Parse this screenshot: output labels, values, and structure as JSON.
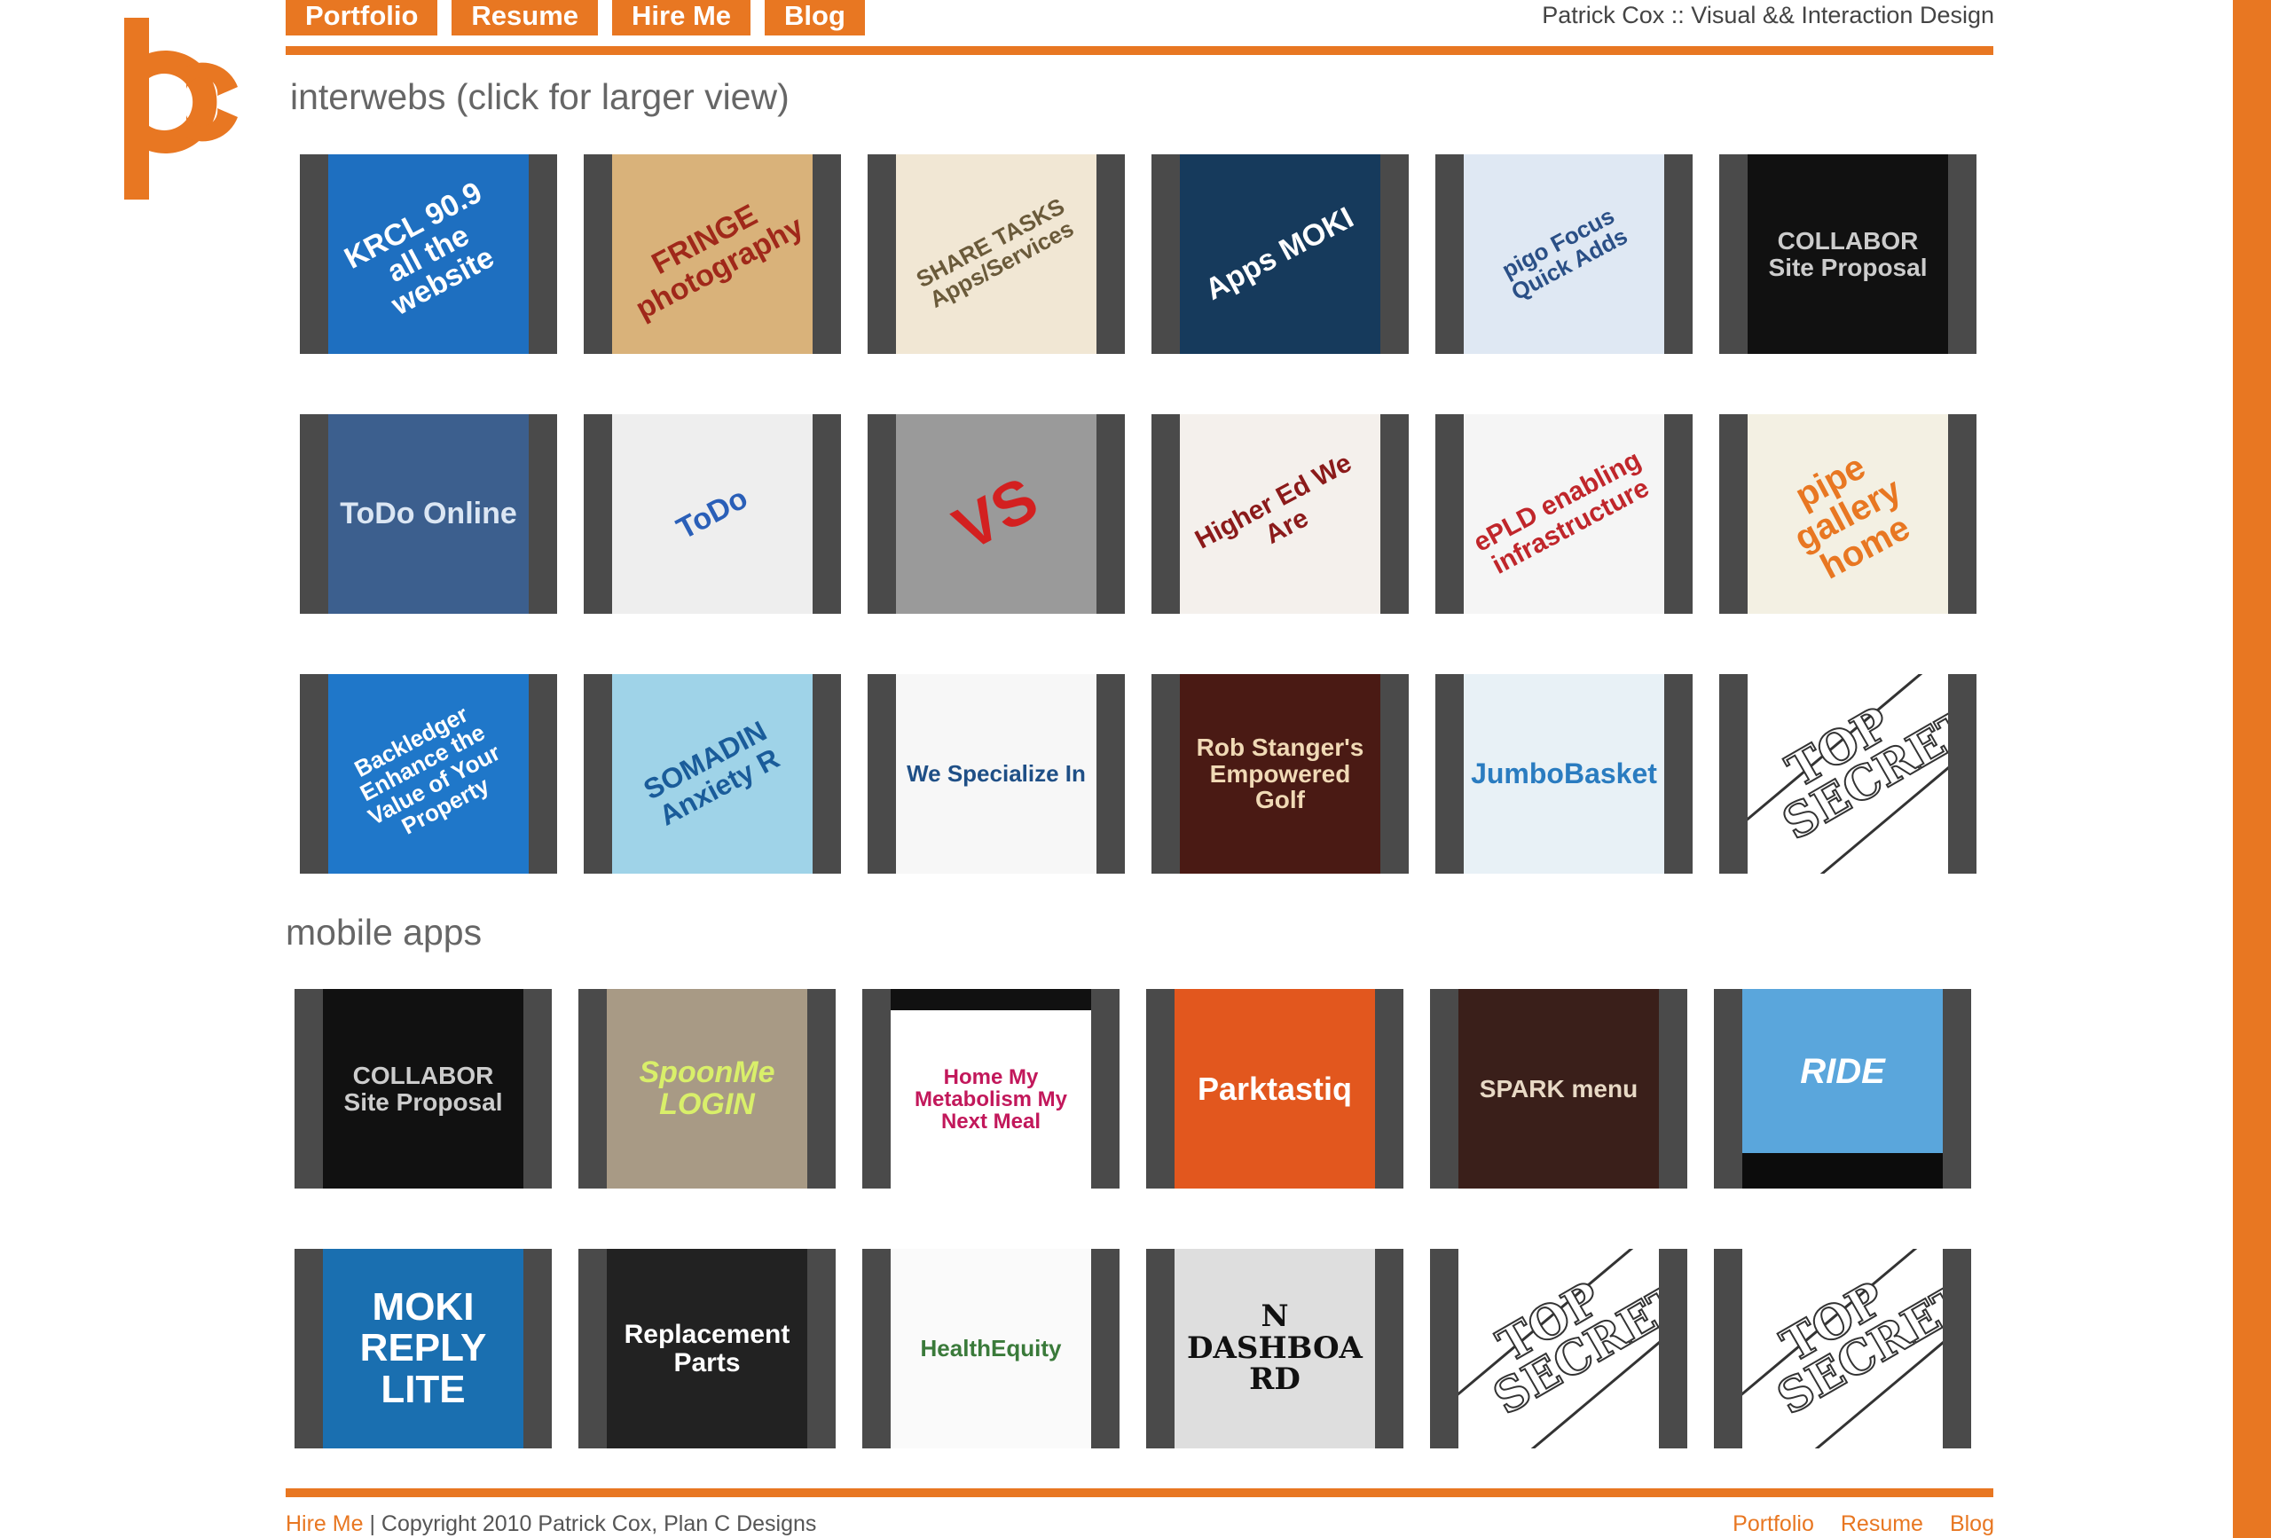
{
  "colors": {
    "accent": "#e87722",
    "tile_frame": "#4a4a4a",
    "text": "#555555"
  },
  "header": {
    "logo_icon": "pc-logo-icon",
    "nav": [
      {
        "label": "Portfolio"
      },
      {
        "label": "Resume"
      },
      {
        "label": "Hire Me"
      },
      {
        "label": "Blog"
      }
    ],
    "site_title": "Patrick Cox :: Visual && Interaction Design"
  },
  "sections": {
    "interwebs": {
      "title": "interwebs (click for larger view)",
      "items": [
        {
          "label": "KRCL 90.9 all the website"
        },
        {
          "label": "FRINGE photography"
        },
        {
          "label": "SHARE TASKS Apps/Services"
        },
        {
          "label": "Apps MOKI"
        },
        {
          "label": "pigo Focus Quick Adds"
        },
        {
          "label": "COLLABOR Site Proposal"
        },
        {
          "label": "ToDo Online"
        },
        {
          "label": "ToDo"
        },
        {
          "label": "VS"
        },
        {
          "label": "Higher Ed We Are"
        },
        {
          "label": "ePLD enabling infrastructure"
        },
        {
          "label": "pipe gallery home"
        },
        {
          "label": "Backledger Enhance the Value of Your Property"
        },
        {
          "label": "SOMADIN Anxiety R"
        },
        {
          "label": "We Specialize In"
        },
        {
          "label": "Rob Stanger's Empowered Golf"
        },
        {
          "label": "JumboBasket"
        },
        {
          "label": "TOP SECRET"
        }
      ]
    },
    "mobile": {
      "title": "mobile apps",
      "items": [
        {
          "label": "COLLABOR Site Proposal"
        },
        {
          "label": "SpoonMe LOGIN"
        },
        {
          "label": "Home My Metabolism My Next Meal"
        },
        {
          "label": "Parktastiq"
        },
        {
          "label": "SPARK menu"
        },
        {
          "label": "RIDE"
        },
        {
          "label": "MOKI REPLY LITE"
        },
        {
          "label": "Replacement Parts"
        },
        {
          "label": "HealthEquity"
        },
        {
          "label": "N DASHBOARD"
        },
        {
          "label": "TOP SECRET"
        },
        {
          "label": "TOP SECRET"
        }
      ]
    }
  },
  "footer": {
    "hire_me": "Hire Me",
    "copyright": "| Copyright 2010 Patrick Cox, Plan C Designs",
    "links": [
      {
        "label": "Portfolio"
      },
      {
        "label": "Resume"
      },
      {
        "label": "Blog"
      }
    ]
  }
}
